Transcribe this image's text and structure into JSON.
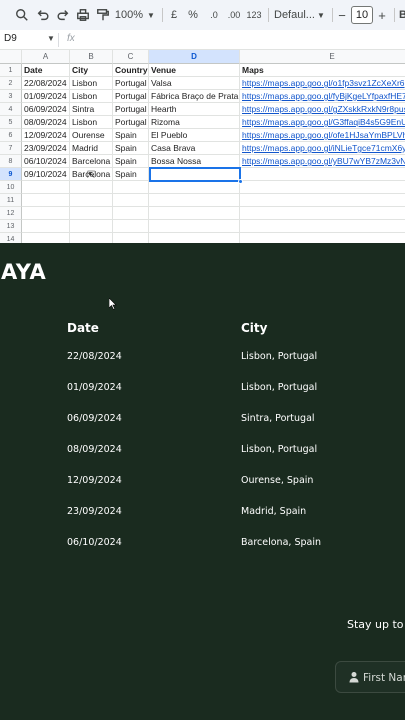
{
  "toolbar": {
    "zoom": "100%",
    "currency": "£",
    "percent": "%",
    "decimal": ".0",
    "decimal_more": ".00",
    "number_format": "123",
    "font": "Defaul...",
    "font_size": "10",
    "minus": "−",
    "plus": "+",
    "bold": "B"
  },
  "formula_bar": {
    "cell_ref": "D9",
    "fx": "fx"
  },
  "grid": {
    "columns": [
      "A",
      "B",
      "C",
      "D",
      "E"
    ],
    "row_numbers": [
      "1",
      "2",
      "3",
      "4",
      "5",
      "6",
      "7",
      "8",
      "9",
      "10",
      "11",
      "12",
      "13",
      "14"
    ],
    "rows": [
      [
        "Date",
        "City",
        "Country",
        "Venue",
        "Maps"
      ],
      [
        "22/08/2024",
        "Lisbon",
        "Portugal",
        "Valsa",
        "https://maps.app.goo.gl/o1fp3svz1ZcXeXr6"
      ],
      [
        "01/09/2024",
        "Lisbon",
        "Portugal",
        "Fábrica Braço de Prata",
        "https://maps.app.goo.gl/fyBjKgeLYfpaxfHE7"
      ],
      [
        "06/09/2024",
        "Sintra",
        "Portugal",
        "Hearth",
        "https://maps.app.goo.gl/gZXskkRxkN9r8pus"
      ],
      [
        "08/09/2024",
        "Lisbon",
        "Portugal",
        "Rizoma",
        "https://maps.app.goo.gl/G3ffaqiB4s5G9EnU"
      ],
      [
        "12/09/2024",
        "Ourense",
        "Spain",
        "El Pueblo",
        "https://maps.app.goo.gl/ofe1HJsaYmBPLVh"
      ],
      [
        "23/09/2024",
        "Madrid",
        "Spain",
        "Casa Brava",
        "https://maps.app.goo.gl/iNLieTgce71cmX6y"
      ],
      [
        "06/10/2024",
        "Barcelona",
        "Spain",
        "Bossa Nossa",
        "https://maps.app.goo.gl/yBU7wYB7zMz3vN"
      ],
      [
        "09/10/2024",
        "Barcelona",
        "Spain",
        "",
        ""
      ]
    ]
  },
  "site": {
    "brand": "AYA",
    "table_headers": {
      "date": "Date",
      "city": "City"
    },
    "events": [
      {
        "date": "22/08/2024",
        "city": "Lisbon, Portugal"
      },
      {
        "date": "01/09/2024",
        "city": "Lisbon, Portugal"
      },
      {
        "date": "06/09/2024",
        "city": "Sintra, Portugal"
      },
      {
        "date": "08/09/2024",
        "city": "Lisbon, Portugal"
      },
      {
        "date": "12/09/2024",
        "city": "Ourense, Spain"
      },
      {
        "date": "23/09/2024",
        "city": "Madrid, Spain"
      },
      {
        "date": "06/10/2024",
        "city": "Barcelona, Spain"
      }
    ],
    "stay_text": "Stay up to",
    "first_name_placeholder": "First Nam"
  },
  "colors": {
    "site_bg": "#1a2b1f",
    "link": "#1155cc",
    "selection": "#1a73e8"
  }
}
